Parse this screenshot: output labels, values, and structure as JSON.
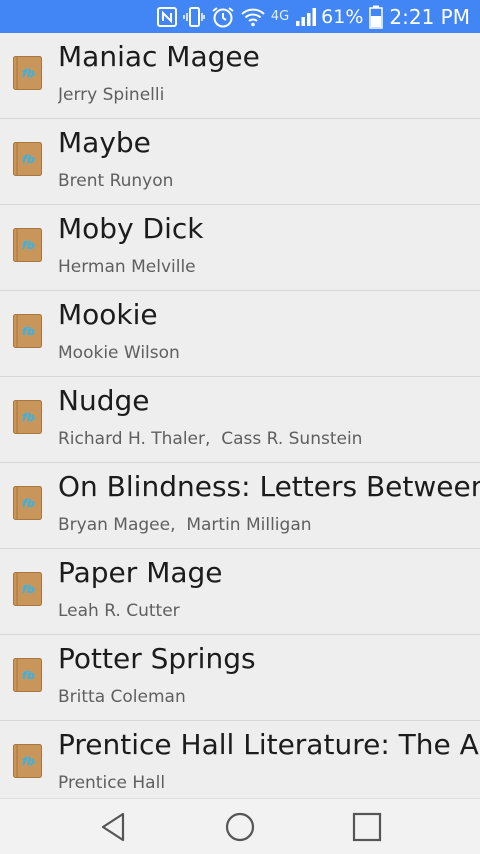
{
  "status_bar": {
    "battery_percent": "61%",
    "battery_level": 0.61,
    "network_label": "4G",
    "time": "2:21 PM",
    "icons": [
      "nfc-icon",
      "vibrate-icon",
      "alarm-icon",
      "wifi-icon",
      "signal-icon",
      "battery-icon"
    ]
  },
  "books": [
    {
      "title": "Maniac Magee",
      "authors": [
        "Jerry Spinelli"
      ]
    },
    {
      "title": "Maybe",
      "authors": [
        "Brent Runyon"
      ]
    },
    {
      "title": "Moby Dick",
      "authors": [
        "Herman Melville"
      ]
    },
    {
      "title": "Mookie",
      "authors": [
        "Mookie Wilson"
      ]
    },
    {
      "title": "Nudge",
      "authors": [
        "Richard H. Thaler",
        "Cass R. Sunstein"
      ]
    },
    {
      "title": "On Blindness: Letters Between B",
      "authors": [
        "Bryan Magee",
        "Martin Milligan"
      ]
    },
    {
      "title": "Paper Mage",
      "authors": [
        "Leah R. Cutter"
      ]
    },
    {
      "title": "Potter Springs",
      "authors": [
        "Britta Coleman"
      ]
    },
    {
      "title": "Prentice Hall Literature: The Am",
      "authors": [
        "Prentice Hall"
      ]
    }
  ],
  "book_icon": {
    "name": "book-cover-icon",
    "glyph": "fb",
    "cover_color": "#C8965A",
    "glyph_color": "#29B6F6"
  },
  "nav_bar": {
    "back": "back-icon",
    "home": "home-icon",
    "recents": "recents-icon"
  },
  "colors": {
    "status_bar": "#4285F4",
    "background": "#EEEEEE",
    "divider": "#D6D6D6"
  }
}
